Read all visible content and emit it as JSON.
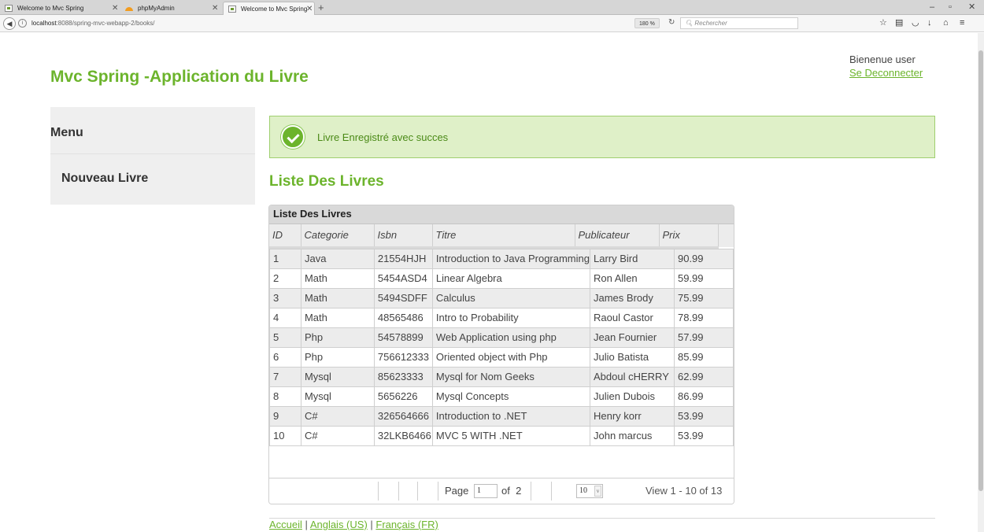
{
  "browser": {
    "tabs": [
      {
        "label": "Welcome to Mvc Spring"
      },
      {
        "label": "phpMyAdmin"
      },
      {
        "label": "Welcome to Mvc Spring"
      }
    ],
    "url_host": "localhost",
    "url_rest": ":8088/spring-mvc-webapp-2/books/",
    "zoom": "180 %",
    "search_placeholder": "Rechercher"
  },
  "header": {
    "title": "Mvc Spring -Application du Livre",
    "welcome": "Bienenue user",
    "logout": "Se Deconnecter"
  },
  "sidebar": {
    "menu_title": "Menu",
    "items": [
      {
        "label": "Nouveau Livre"
      }
    ]
  },
  "alert": {
    "message": "Livre Enregistré avec succes"
  },
  "main": {
    "heading": "Liste Des Livres"
  },
  "grid": {
    "caption": "Liste Des Livres",
    "columns": [
      "ID",
      "Categorie",
      "Isbn",
      "Titre",
      "Publicateur",
      "Prix"
    ],
    "rows": [
      [
        "1",
        "Java",
        "21554HJH",
        "Introduction to Java Programming",
        "Larry Bird",
        "90.99"
      ],
      [
        "2",
        "Math",
        "5454ASD4",
        "Linear Algebra",
        "Ron Allen",
        "59.99"
      ],
      [
        "3",
        "Math",
        "5494SDFF",
        "Calculus",
        "James Brody",
        "75.99"
      ],
      [
        "4",
        "Math",
        "48565486",
        "Intro to Probability",
        "Raoul Castor",
        "78.99"
      ],
      [
        "5",
        "Php",
        "54578899",
        "Web Application using php",
        "Jean Fournier",
        "57.99"
      ],
      [
        "6",
        "Php",
        "756612333",
        "Oriented object with Php",
        "Julio Batista",
        "85.99"
      ],
      [
        "7",
        "Mysql",
        "85623333",
        "Mysql for Nom Geeks",
        "Abdoul cHERRY",
        "62.99"
      ],
      [
        "8",
        "Mysql",
        "5656226",
        "Mysql Concepts",
        "Julien Dubois",
        "86.99"
      ],
      [
        "9",
        "C#",
        "326564666",
        "Introduction to .NET",
        "Henry korr",
        "53.99"
      ],
      [
        "10",
        "C#",
        "32LKB6466",
        "MVC 5 WITH .NET",
        "John marcus",
        "53.99"
      ]
    ],
    "pager": {
      "page_label": "Page",
      "page_value": "1",
      "of_label": "of",
      "total_pages": "2",
      "rows_per_page": "10",
      "view_info": "View 1 - 10 of 13"
    }
  },
  "footer": {
    "links": [
      "Accueil",
      "Anglais (US)",
      "Français (FR)"
    ],
    "separator": " | "
  }
}
